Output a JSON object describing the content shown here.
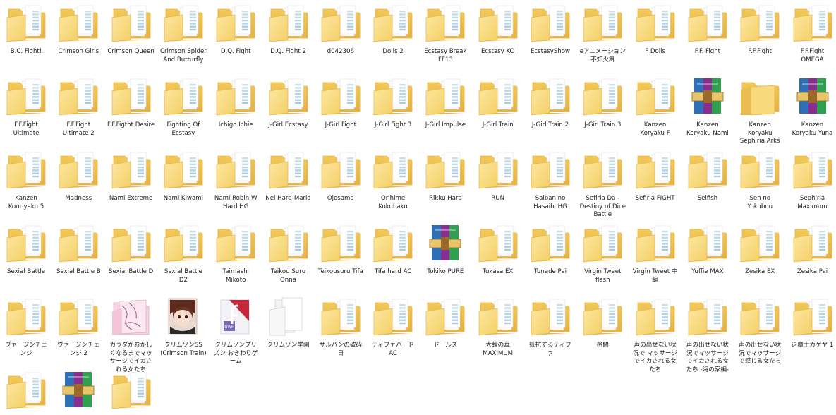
{
  "window": {
    "title": "",
    "view": "large icons"
  },
  "folder_colors": {
    "back": "#F0C552",
    "front": "#F9DD86",
    "edge": "#E7B645",
    "paper": "#FFFFFF",
    "paper_lines": "#9FC6DA"
  },
  "items": [
    {
      "label": "B.C. Fight!",
      "icon": "folder-with-papers-icon"
    },
    {
      "label": "Crimson Girls",
      "icon": "folder-with-papers-icon"
    },
    {
      "label": "Crimson Queen",
      "icon": "folder-with-papers-icon"
    },
    {
      "label": "Crimson Spider And Butturfly",
      "icon": "folder-with-papers-icon"
    },
    {
      "label": "D.Q. Fight",
      "icon": "folder-with-papers-icon"
    },
    {
      "label": "D.Q. Fight 2",
      "icon": "folder-with-papers-icon"
    },
    {
      "label": "d042306",
      "icon": "folder-with-papers-icon"
    },
    {
      "label": "Dolls 2",
      "icon": "folder-with-papers-icon"
    },
    {
      "label": "Ecstasy Break FF13",
      "icon": "folder-with-papers-icon"
    },
    {
      "label": "Ecstasy KO",
      "icon": "folder-with-papers-icon"
    },
    {
      "label": "EcstasyShow",
      "icon": "folder-with-papers-icon"
    },
    {
      "label": "eアニメーション 不知火舞",
      "icon": "folder-with-papers-icon"
    },
    {
      "label": "F Dolls",
      "icon": "folder-with-papers-icon"
    },
    {
      "label": "F.F. Fight",
      "icon": "folder-with-papers-icon"
    },
    {
      "label": "F.F.Fight",
      "icon": "folder-with-papers-icon"
    },
    {
      "label": "F.F.Fight OMEGA",
      "icon": "folder-with-papers-icon"
    },
    {
      "label": "F.F.Fight Ultimate",
      "icon": "folder-with-papers-icon"
    },
    {
      "label": "F.F.Fight Ultimate 2",
      "icon": "folder-with-papers-icon"
    },
    {
      "label": "F.F.Figtht Desire",
      "icon": "folder-with-papers-icon"
    },
    {
      "label": "Fighting Of Ecstasy",
      "icon": "folder-with-papers-icon"
    },
    {
      "label": "Ichigo Ichie",
      "icon": "folder-with-papers-icon"
    },
    {
      "label": "J-Girl Ecstasy",
      "icon": "folder-with-papers-icon"
    },
    {
      "label": "J-Girl Fight",
      "icon": "folder-with-papers-icon"
    },
    {
      "label": "J-Girl Fight 3",
      "icon": "folder-with-papers-icon"
    },
    {
      "label": "J-Girl Impulse",
      "icon": "folder-with-papers-icon"
    },
    {
      "label": "J-Girl Train",
      "icon": "folder-with-papers-icon"
    },
    {
      "label": "J-Girl Train 2",
      "icon": "folder-with-papers-icon"
    },
    {
      "label": "J-Girl Train 3",
      "icon": "folder-with-papers-icon"
    },
    {
      "label": "Kanzen Koryaku F",
      "icon": "folder-with-papers-icon"
    },
    {
      "label": "Kanzen Koryaku Nami",
      "icon": "winrar-archive-icon"
    },
    {
      "label": "Kanzen Koryaku Sephiria Arks",
      "icon": "empty-folder-icon"
    },
    {
      "label": "Kanzen Koryaku Yuna",
      "icon": "winrar-archive-icon"
    },
    {
      "label": "Kanzen Kouriyaku 5",
      "icon": "folder-with-papers-icon"
    },
    {
      "label": "Madness",
      "icon": "folder-with-papers-icon"
    },
    {
      "label": "Nami Extreme",
      "icon": "folder-with-papers-icon"
    },
    {
      "label": "Nami Kiwami",
      "icon": "folder-with-papers-icon"
    },
    {
      "label": "Nami Robin W Hard HG",
      "icon": "folder-with-papers-icon"
    },
    {
      "label": "Nel Hard-Maria",
      "icon": "folder-with-papers-icon"
    },
    {
      "label": "Ojosama",
      "icon": "folder-with-papers-icon"
    },
    {
      "label": "Orihime Kokuhaku",
      "icon": "folder-with-papers-icon"
    },
    {
      "label": "Rikku Hard",
      "icon": "folder-with-papers-icon"
    },
    {
      "label": "RUN",
      "icon": "folder-with-papers-icon"
    },
    {
      "label": "Saiban no Hasaibi HG",
      "icon": "folder-with-papers-icon"
    },
    {
      "label": "Sefiria Da - Destiny of Dice Battle",
      "icon": "folder-with-papers-icon"
    },
    {
      "label": "Sefiria FIGHT",
      "icon": "folder-with-papers-icon"
    },
    {
      "label": "Selfish",
      "icon": "folder-with-papers-icon"
    },
    {
      "label": "Sen no Yokubou",
      "icon": "folder-with-papers-icon"
    },
    {
      "label": "Sephiria Maximum",
      "icon": "folder-with-papers-icon"
    },
    {
      "label": "Sexial Battle",
      "icon": "folder-with-papers-icon"
    },
    {
      "label": "Sexial Battle B",
      "icon": "folder-with-papers-icon"
    },
    {
      "label": "Sexial Battle D",
      "icon": "folder-with-papers-icon"
    },
    {
      "label": "Sexial Battle D2",
      "icon": "folder-with-papers-icon"
    },
    {
      "label": "Taimashi Mikoto",
      "icon": "folder-with-papers-icon"
    },
    {
      "label": "Teikou Suru Onna",
      "icon": "folder-with-papers-icon"
    },
    {
      "label": "Teikousuru Tifa",
      "icon": "folder-with-papers-icon"
    },
    {
      "label": "Tifa hard AC",
      "icon": "folder-with-papers-icon"
    },
    {
      "label": "Tokiko PURE",
      "icon": "winrar-archive-icon"
    },
    {
      "label": "Tukasa EX",
      "icon": "folder-with-papers-icon"
    },
    {
      "label": "Tunade Pai",
      "icon": "folder-with-papers-icon"
    },
    {
      "label": "Virgin Tweet flash",
      "icon": "folder-with-papers-icon"
    },
    {
      "label": "Virgin Tweet 中編",
      "icon": "folder-with-papers-icon"
    },
    {
      "label": "Yuffie MAX",
      "icon": "folder-with-papers-icon"
    },
    {
      "label": "Zesika EX",
      "icon": "folder-with-papers-icon"
    },
    {
      "label": "Zesika Pai",
      "icon": "folder-with-papers-icon"
    },
    {
      "label": "ヴァージンチェンジ",
      "icon": "folder-with-papers-icon"
    },
    {
      "label": "ヴァージンチェンジ 2",
      "icon": "folder-with-papers-icon"
    },
    {
      "label": "カラダがおかしくなるまでマッサージでイカされる女たち",
      "icon": "pink-image-folder-icon"
    },
    {
      "label": "クリムゾンSS (Crimson Train)",
      "icon": "anime-portrait-folder-icon"
    },
    {
      "label": "クリムゾンプリズン おきわりゲーム",
      "icon": "swf-file-folder-icon"
    },
    {
      "label": "クリムゾン学園",
      "icon": "white-papers-folder-icon"
    },
    {
      "label": "サルバンの破砕日",
      "icon": "folder-with-papers-icon"
    },
    {
      "label": "ティファハード AC",
      "icon": "folder-with-papers-icon"
    },
    {
      "label": "ドールズ",
      "icon": "folder-with-papers-icon"
    },
    {
      "label": "大輪の華 MAXIMUM",
      "icon": "folder-with-papers-icon"
    },
    {
      "label": "抵抗するティファ",
      "icon": "folder-with-papers-icon"
    },
    {
      "label": "格闘",
      "icon": "folder-with-papers-icon"
    },
    {
      "label": "声の出せない状況で マッサージでイカされる女たち",
      "icon": "folder-with-papers-icon"
    },
    {
      "label": "声の出せない状況でマッサージでイカされる女たち -海の家編-",
      "icon": "folder-with-papers-icon"
    },
    {
      "label": "声の出せない状況でマッサージで感じる女たち",
      "icon": "folder-with-papers-icon"
    },
    {
      "label": "退魔士カゲヤ 1",
      "icon": "folder-with-papers-icon"
    },
    {
      "label": "",
      "icon": "folder-with-papers-icon"
    },
    {
      "label": "",
      "icon": "winrar-archive-icon"
    },
    {
      "label": "",
      "icon": "folder-with-papers-icon"
    }
  ]
}
